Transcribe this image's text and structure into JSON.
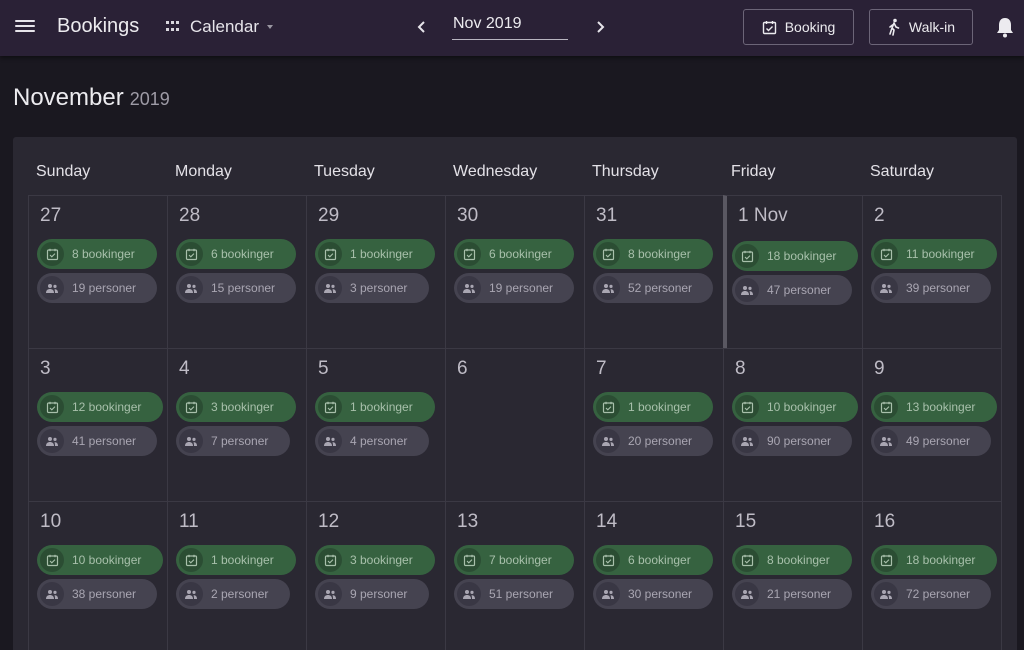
{
  "header": {
    "app_title": "Bookings",
    "view_label": "Calendar",
    "month_value": "Nov 2019",
    "booking_button": "Booking",
    "walkin_button": "Walk-in"
  },
  "page": {
    "month": "November",
    "year": "2019"
  },
  "colors": {
    "topbar": "#2a2136",
    "booking_pill": "#366240",
    "people_pill": "#454350",
    "background": "#1a1820",
    "card": "#2a2832"
  },
  "icons": {
    "menu": "menu-icon",
    "view": "grid-icon",
    "prev": "chevron-left-icon",
    "next": "chevron-right-icon",
    "booking": "calendar-check-icon",
    "walkin": "walking-person-icon",
    "bell": "bell-icon",
    "pill_booking": "calendar-check-icon",
    "pill_people": "people-icon"
  },
  "weekdays": [
    "Sunday",
    "Monday",
    "Tuesday",
    "Wednesday",
    "Thursday",
    "Friday",
    "Saturday"
  ],
  "days": [
    {
      "day": "27",
      "bookings": "8 bookinger",
      "people": "19 personer"
    },
    {
      "day": "28",
      "bookings": "6 bookinger",
      "people": "15 personer"
    },
    {
      "day": "29",
      "bookings": "1 bookinger",
      "people": "3 personer"
    },
    {
      "day": "30",
      "bookings": "6 bookinger",
      "people": "19 personer"
    },
    {
      "day": "31",
      "bookings": "8 bookinger",
      "people": "52 personer"
    },
    {
      "day": "1 Nov",
      "bookings": "18 bookinger",
      "people": "47 personer",
      "today": true
    },
    {
      "day": "2",
      "bookings": "11 bookinger",
      "people": "39 personer"
    },
    {
      "day": "3",
      "bookings": "12 bookinger",
      "people": "41 personer"
    },
    {
      "day": "4",
      "bookings": "3 bookinger",
      "people": "7 personer"
    },
    {
      "day": "5",
      "bookings": "1 bookinger",
      "people": "4 personer"
    },
    {
      "day": "6",
      "bookings": null,
      "people": null
    },
    {
      "day": "7",
      "bookings": "1 bookinger",
      "people": "20 personer"
    },
    {
      "day": "8",
      "bookings": "10 bookinger",
      "people": "90 personer"
    },
    {
      "day": "9",
      "bookings": "13 bookinger",
      "people": "49 personer"
    },
    {
      "day": "10",
      "bookings": "10 bookinger",
      "people": "38 personer"
    },
    {
      "day": "11",
      "bookings": "1 bookinger",
      "people": "2 personer"
    },
    {
      "day": "12",
      "bookings": "3 bookinger",
      "people": "9 personer"
    },
    {
      "day": "13",
      "bookings": "7 bookinger",
      "people": "51 personer"
    },
    {
      "day": "14",
      "bookings": "6 bookinger",
      "people": "30 personer"
    },
    {
      "day": "15",
      "bookings": "8 bookinger",
      "people": "21 personer"
    },
    {
      "day": "16",
      "bookings": "18 bookinger",
      "people": "72 personer"
    }
  ]
}
